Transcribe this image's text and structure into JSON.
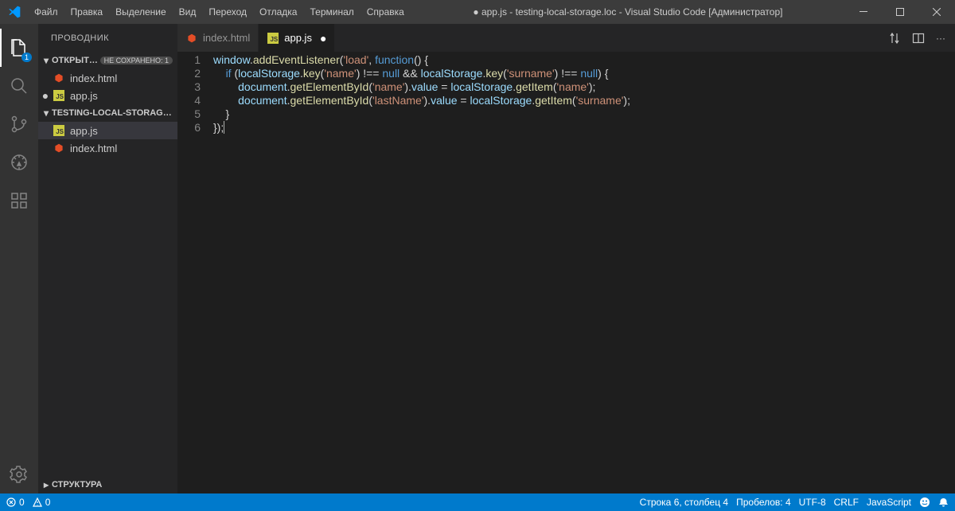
{
  "title": "● app.js - testing-local-storage.loc - Visual Studio Code [Администратор]",
  "menu": [
    "Файл",
    "Правка",
    "Выделение",
    "Вид",
    "Переход",
    "Отладка",
    "Терминал",
    "Справка"
  ],
  "activity": {
    "explorer_badge": "1"
  },
  "sidebar": {
    "title": "ПРОВОДНИК",
    "open_editors": {
      "label": "ОТКРЫТЫЕ Р...",
      "badge": "НЕ СОХРАНЕНО: 1",
      "items": [
        {
          "label": "index.html",
          "dirty": false,
          "type": "html"
        },
        {
          "label": "app.js",
          "dirty": true,
          "type": "js"
        }
      ]
    },
    "workspace": {
      "label": "TESTING-LOCAL-STORAGE.LOC",
      "items": [
        {
          "label": "app.js",
          "type": "js",
          "selected": true
        },
        {
          "label": "index.html",
          "type": "html",
          "selected": false
        }
      ]
    },
    "outline": "СТРУКТУРА"
  },
  "tabs": [
    {
      "label": "index.html",
      "type": "html",
      "active": false,
      "dirty": false
    },
    {
      "label": "app.js",
      "type": "js",
      "active": true,
      "dirty": true
    }
  ],
  "code": {
    "line_numbers": [
      "1",
      "2",
      "3",
      "4",
      "5",
      "6"
    ],
    "lines": [
      [
        {
          "c": "obj",
          "t": "window"
        },
        {
          "c": "pun",
          "t": "."
        },
        {
          "c": "fn",
          "t": "addEventListener"
        },
        {
          "c": "pun",
          "t": "("
        },
        {
          "c": "str",
          "t": "'load'"
        },
        {
          "c": "pun",
          "t": ", "
        },
        {
          "c": "kw",
          "t": "function"
        },
        {
          "c": "pun",
          "t": "() {"
        }
      ],
      [
        {
          "c": "pun",
          "t": "    "
        },
        {
          "c": "kw",
          "t": "if"
        },
        {
          "c": "pun",
          "t": " ("
        },
        {
          "c": "obj",
          "t": "localStorage"
        },
        {
          "c": "pun",
          "t": "."
        },
        {
          "c": "fn",
          "t": "key"
        },
        {
          "c": "pun",
          "t": "("
        },
        {
          "c": "str",
          "t": "'name'"
        },
        {
          "c": "pun",
          "t": ") !== "
        },
        {
          "c": "kw",
          "t": "null"
        },
        {
          "c": "pun",
          "t": " && "
        },
        {
          "c": "obj",
          "t": "localStorage"
        },
        {
          "c": "pun",
          "t": "."
        },
        {
          "c": "fn",
          "t": "key"
        },
        {
          "c": "pun",
          "t": "("
        },
        {
          "c": "str",
          "t": "'surname'"
        },
        {
          "c": "pun",
          "t": ") !== "
        },
        {
          "c": "kw",
          "t": "null"
        },
        {
          "c": "pun",
          "t": ") {"
        }
      ],
      [
        {
          "c": "pun",
          "t": "        "
        },
        {
          "c": "obj",
          "t": "document"
        },
        {
          "c": "pun",
          "t": "."
        },
        {
          "c": "fn",
          "t": "getElementById"
        },
        {
          "c": "pun",
          "t": "("
        },
        {
          "c": "str",
          "t": "'name'"
        },
        {
          "c": "pun",
          "t": ")."
        },
        {
          "c": "obj",
          "t": "value"
        },
        {
          "c": "pun",
          "t": " = "
        },
        {
          "c": "obj",
          "t": "localStorage"
        },
        {
          "c": "pun",
          "t": "."
        },
        {
          "c": "fn",
          "t": "getItem"
        },
        {
          "c": "pun",
          "t": "("
        },
        {
          "c": "str",
          "t": "'name'"
        },
        {
          "c": "pun",
          "t": ");"
        }
      ],
      [
        {
          "c": "pun",
          "t": "        "
        },
        {
          "c": "obj",
          "t": "document"
        },
        {
          "c": "pun",
          "t": "."
        },
        {
          "c": "fn",
          "t": "getElementById"
        },
        {
          "c": "pun",
          "t": "("
        },
        {
          "c": "str",
          "t": "'lastName'"
        },
        {
          "c": "pun",
          "t": ")."
        },
        {
          "c": "obj",
          "t": "value"
        },
        {
          "c": "pun",
          "t": " = "
        },
        {
          "c": "obj",
          "t": "localStorage"
        },
        {
          "c": "pun",
          "t": "."
        },
        {
          "c": "fn",
          "t": "getItem"
        },
        {
          "c": "pun",
          "t": "("
        },
        {
          "c": "str",
          "t": "'surname'"
        },
        {
          "c": "pun",
          "t": ");"
        }
      ],
      [
        {
          "c": "pun",
          "t": "    }"
        }
      ],
      [
        {
          "c": "pun",
          "t": "});"
        }
      ]
    ]
  },
  "status": {
    "errors": "0",
    "warnings": "0",
    "ln_col": "Строка 6, столбец 4",
    "spaces": "Пробелов: 4",
    "encoding": "UTF-8",
    "eol": "CRLF",
    "lang": "JavaScript"
  }
}
